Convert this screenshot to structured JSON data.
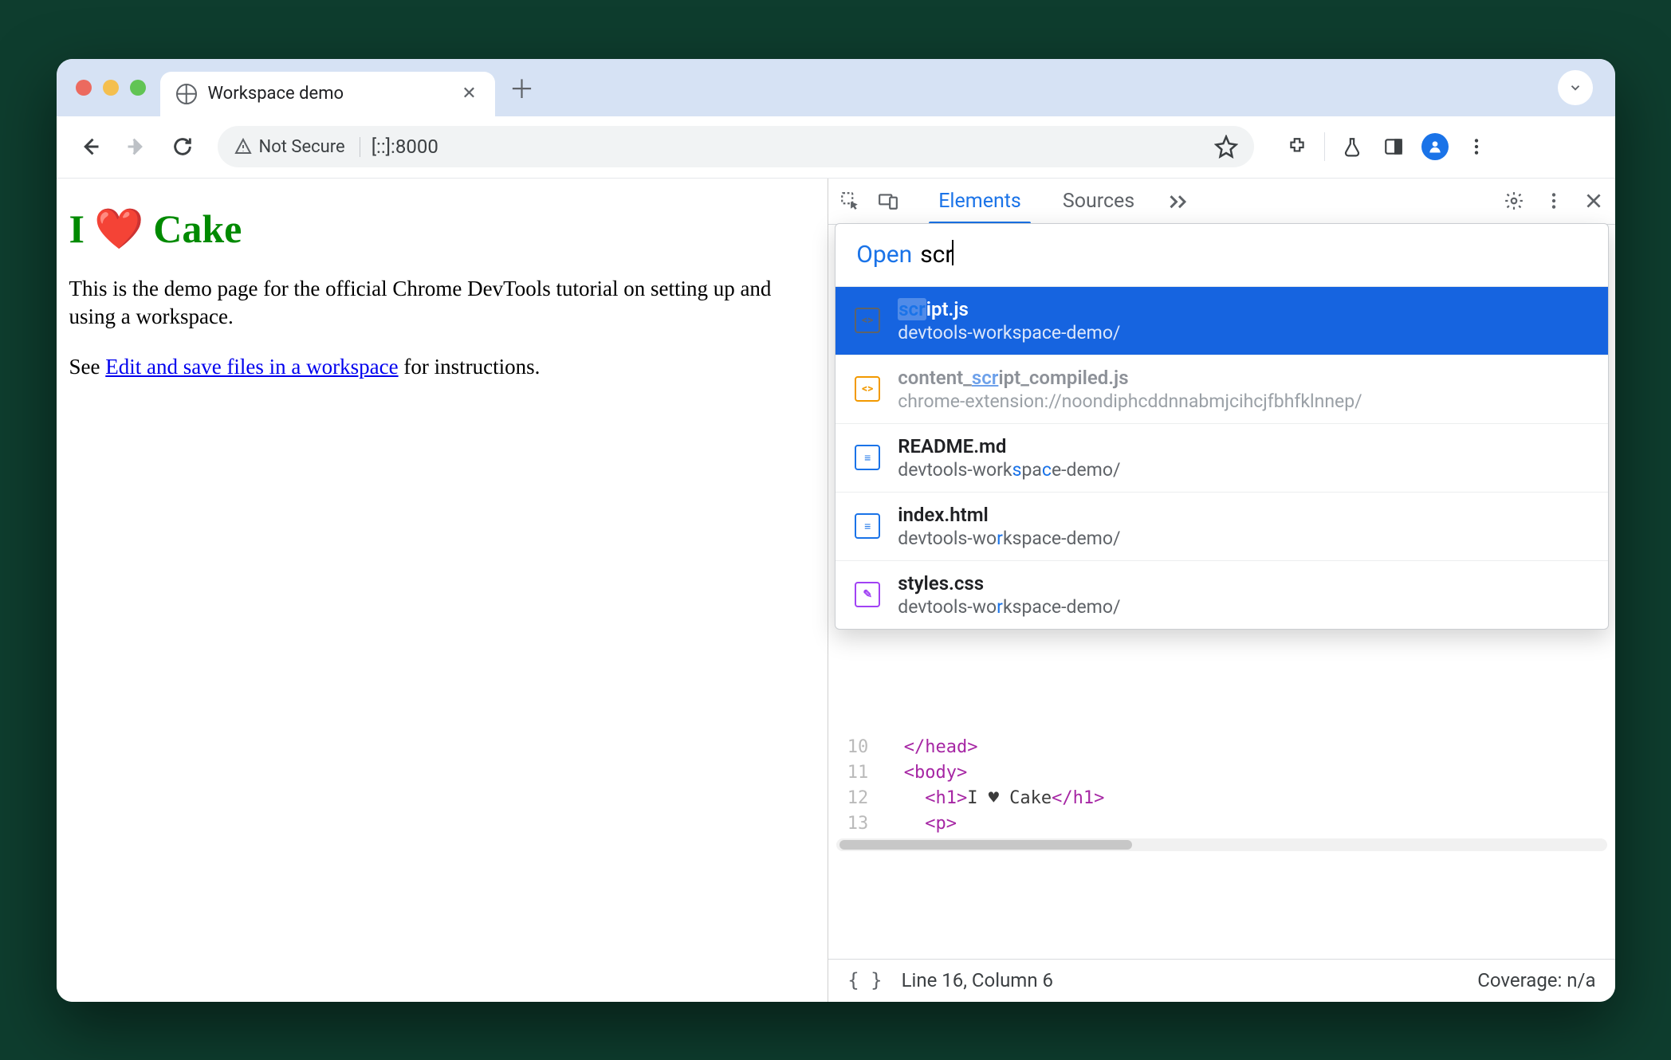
{
  "tab": {
    "title": "Workspace demo"
  },
  "addressbar": {
    "security_label": "Not Secure",
    "url": "[::]:8000"
  },
  "page": {
    "heading_prefix": "I",
    "heading_emoji": "❤️",
    "heading_suffix": "Cake",
    "paragraph1": "This is the demo page for the official Chrome DevTools tutorial on setting up and using a workspace.",
    "paragraph2_prefix": "See ",
    "paragraph2_link": "Edit and save files in a workspace",
    "paragraph2_suffix": " for instructions."
  },
  "devtools": {
    "tabs": {
      "elements": "Elements",
      "sources": "Sources"
    },
    "open": {
      "label": "Open",
      "query": "scr",
      "results": [
        {
          "name_pre": "",
          "name_hl": "scr",
          "name_post": "ipt.js",
          "path": "devtools-workspace-demo/",
          "icon": "js-dark",
          "selected": true
        },
        {
          "name_pre": "content_",
          "name_hl": "scr",
          "name_post": "ipt_compiled.js",
          "path": "chrome-extension://noondiphcddnnabmjcihcjfbhfklnnep/",
          "icon": "js",
          "dimmed": true
        },
        {
          "name_plain": "README.md",
          "path_pre": "devtools-work",
          "path_hl1": "s",
          "path_mid": "pa",
          "path_hl2": "c",
          "path_post": "e-demo/",
          "icon": "doc"
        },
        {
          "name_plain": "index.html",
          "path_pre": "devtools-wo",
          "path_hl1": "r",
          "path_mid": "kspace-demo/",
          "icon": "doc"
        },
        {
          "name_plain": "styles.css",
          "path_pre": "devtools-wo",
          "path_hl1": "r",
          "path_mid": "kspace-demo/",
          "icon": "css"
        }
      ]
    },
    "code": {
      "lines": [
        {
          "n": "10",
          "html": "  </head>",
          "ang": true,
          "tag": "head",
          "close": true
        },
        {
          "n": "11",
          "html": "  <body>"
        },
        {
          "n": "12",
          "html": "    <h1>I ♥ Cake</h1>"
        },
        {
          "n": "13",
          "html": "    <p>"
        }
      ]
    },
    "footer": {
      "position": "Line 16, Column 6",
      "coverage": "Coverage: n/a"
    }
  }
}
